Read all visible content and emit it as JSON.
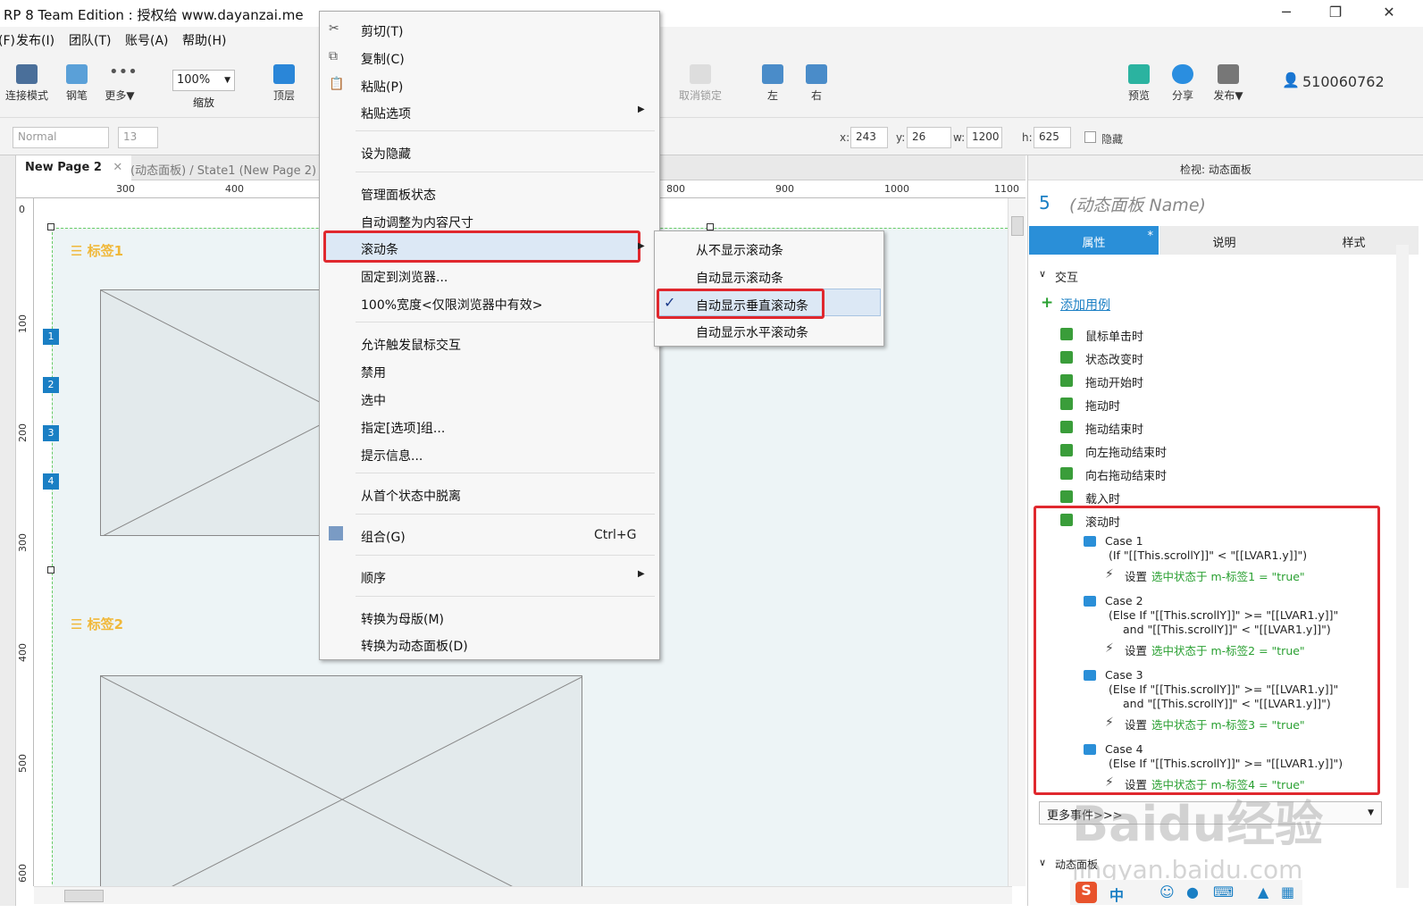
{
  "window": {
    "title": "RP 8 Team Edition : 授权给 www.dayanzai.me",
    "min": "─",
    "restore": "❐",
    "close": "✕"
  },
  "menu": [
    "文件(F)",
    "发布(I)",
    "团队(T)",
    "账号(A)",
    "帮助(H)"
  ],
  "toolbar": {
    "connect": "连接模式",
    "pen": "钢笔",
    "more": "更多▼",
    "zoom_value": "100%",
    "zoom": "缩放",
    "top": "顶层",
    "unlock": "取消锁定",
    "left": "左",
    "right": "右",
    "preview": "预览",
    "share": "分享",
    "publish": "发布▼",
    "user": "510060762"
  },
  "format": {
    "style": "Normal",
    "size": "13",
    "x_label": "x:",
    "x": "243",
    "y_label": "y:",
    "y": "26",
    "w_label": "w:",
    "w": "1200",
    "h_label": "h:",
    "h": "625",
    "hidden": "隐藏"
  },
  "tabs": [
    {
      "label": "New Page 2"
    },
    {
      "label": "(动态面板) / State1 (New Page 2)"
    }
  ],
  "ruler_h": [
    "300",
    "400",
    "800",
    "900",
    "1000",
    "1100"
  ],
  "ruler_v": [
    "0",
    "100",
    "200",
    "300",
    "400",
    "500",
    "600"
  ],
  "canvas": {
    "label1": "标签1",
    "label2": "标签2",
    "markers": [
      "1",
      "2",
      "3",
      "4"
    ]
  },
  "context_menu": {
    "cut": "剪切(T)",
    "copy": "复制(C)",
    "paste": "粘贴(P)",
    "paste_opts": "粘贴选项",
    "set_hidden": "设为隐藏",
    "manage_states": "管理面板状态",
    "fit_content": "自动调整为内容尺寸",
    "scrollbars": "滚动条",
    "pin_browser": "固定到浏览器...",
    "full_width": "100%宽度<仅限浏览器中有效>",
    "allow_mouse": "允许触发鼠标交互",
    "disable": "禁用",
    "selected": "选中",
    "assign_group": "指定[选项]组...",
    "tooltip": "提示信息...",
    "break_first": "从首个状态中脱离",
    "group": "组合(G)",
    "group_key": "Ctrl+G",
    "order": "顺序",
    "to_master": "转换为母版(M)",
    "to_panel": "转换为动态面板(D)"
  },
  "submenu": {
    "never": "从不显示滚动条",
    "auto": "自动显示滚动条",
    "auto_v": "自动显示垂直滚动条",
    "auto_h": "自动显示水平滚动条",
    "check": "✓"
  },
  "inspector": {
    "title": "检视: 动态面板",
    "num": "5",
    "name": "(动态面板 Name)",
    "tabs": [
      "属性",
      "说明",
      "样式"
    ],
    "tab_mark": "*",
    "section": "交互",
    "add_case": "添加用例",
    "events": [
      "鼠标单击时",
      "状态改变时",
      "拖动开始时",
      "拖动时",
      "拖动结束时",
      "向左拖动结束时",
      "向右拖动结束时",
      "载入时",
      "滚动时"
    ],
    "cases": [
      {
        "name": "Case 1",
        "cond": [
          "(If \"[[This.scrollY]]\" < \"[[LVAR1.y]]\")"
        ],
        "action_prefix": "设置",
        "action": "选中状态于 m-标签1 = \"true\""
      },
      {
        "name": "Case 2",
        "cond": [
          "(Else If \"[[This.scrollY]]\" >= \"[[LVAR1.y]]\"",
          "and \"[[This.scrollY]]\" < \"[[LVAR1.y]]\")"
        ],
        "action_prefix": "设置",
        "action": "选中状态于 m-标签2 = \"true\""
      },
      {
        "name": "Case 3",
        "cond": [
          "(Else If \"[[This.scrollY]]\" >= \"[[LVAR1.y]]\"",
          "and \"[[This.scrollY]]\" < \"[[LVAR1.y]]\")"
        ],
        "action_prefix": "设置",
        "action": "选中状态于 m-标签3 = \"true\""
      },
      {
        "name": "Case 4",
        "cond": [
          "(Else If \"[[This.scrollY]]\" >= \"[[LVAR1.y]]\")"
        ],
        "action_prefix": "设置",
        "action": "选中状态于 m-标签4 = \"true\""
      }
    ],
    "more_events": "更多事件>>>",
    "panel_section": "动态面板"
  },
  "watermark": "Baidu经验",
  "watermark_url": "jingyan.baidu.com",
  "ime": "中"
}
